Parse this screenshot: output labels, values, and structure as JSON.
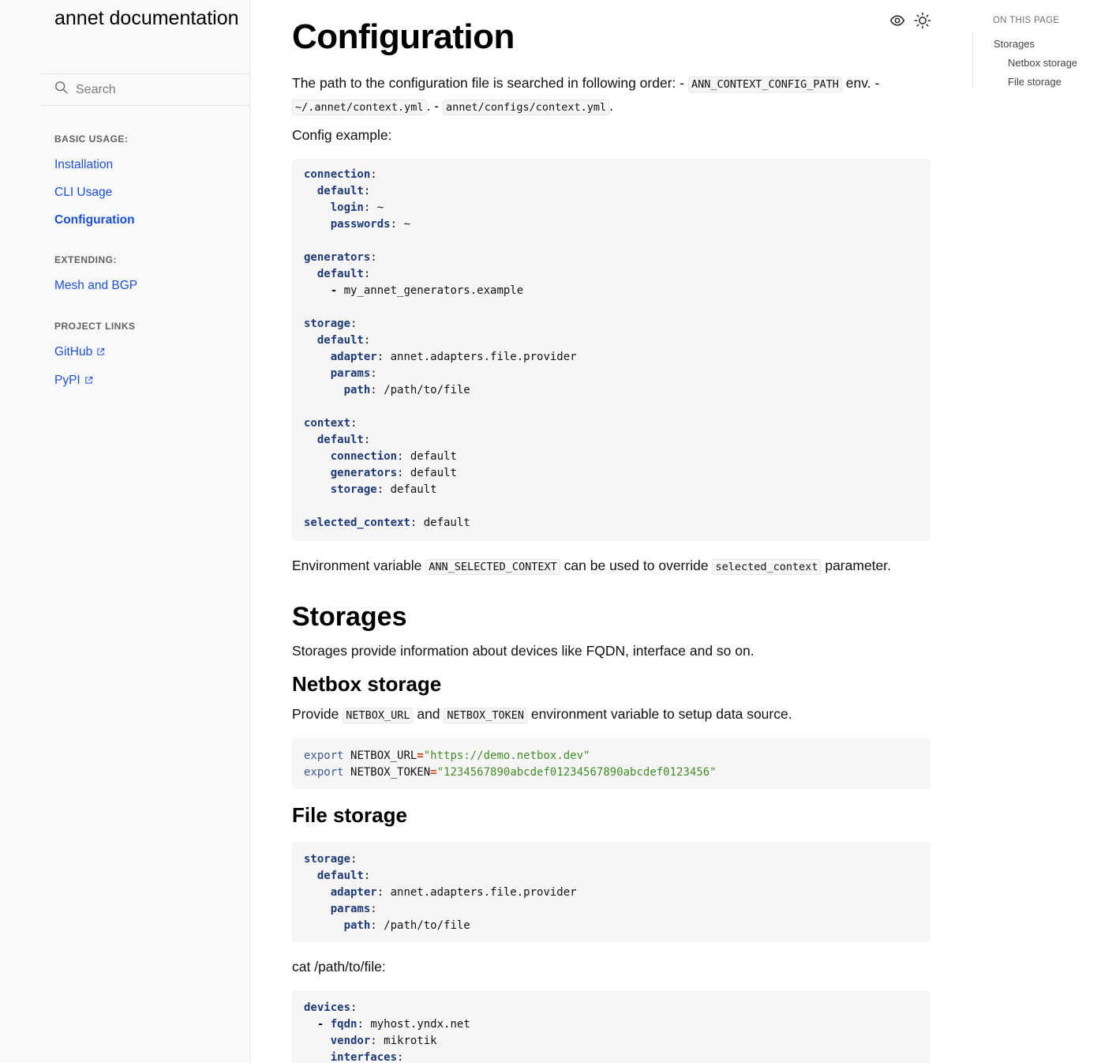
{
  "sidebar": {
    "brand": "annet documentation",
    "search_placeholder": "Search",
    "sections": [
      {
        "caption": "BASIC USAGE:",
        "items": [
          "Installation",
          "CLI Usage",
          "Configuration"
        ]
      },
      {
        "caption": "EXTENDING:",
        "items": [
          "Mesh and BGP"
        ]
      },
      {
        "caption": "PROJECT LINKS",
        "items": [
          "GitHub",
          "PyPI"
        ]
      }
    ],
    "current": "Configuration"
  },
  "toolbar": {
    "view_source_icon": "eye-icon",
    "theme_icon": "sun-icon"
  },
  "toc": {
    "caption": "ON THIS PAGE",
    "items": [
      "Storages",
      "Netbox storage",
      "File storage"
    ]
  },
  "main": {
    "title": "Configuration",
    "intro": {
      "p1_a": "The path to the configuration file is searched in following order: - ",
      "p1_code1": "ANN_CONTEXT_CONFIG_PATH",
      "p1_b": " env. - ",
      "p1_code2": "~/.annet/context.yml",
      "p1_c": ". - ",
      "p1_code3": "annet/configs/context.yml",
      "p1_d": "."
    },
    "config_example_label": "Config example:",
    "env_para": {
      "a": "Environment variable ",
      "code1": "ANN_SELECTED_CONTEXT",
      "b": " can be used to override ",
      "code2": "selected_context",
      "c": " parameter."
    },
    "storages_title": "Storages",
    "storages_text": "Storages provide information about devices like FQDN, interface and so on.",
    "netbox_title": "Netbox storage",
    "netbox_para": {
      "a": "Provide ",
      "code1": "NETBOX_URL",
      "b": " and ",
      "code2": "NETBOX_TOKEN",
      "c": " environment variable to setup data source."
    },
    "netbox_code": {
      "export": "export",
      "var1": "NETBOX_URL",
      "val1": "\"https://demo.netbox.dev\"",
      "var2": "NETBOX_TOKEN",
      "val2": "\"1234567890abcdef01234567890abcdef0123456\""
    },
    "file_title": "File storage",
    "cat_label": "cat /path/to/file:",
    "yaml": {
      "connection": "connection",
      "default": "default",
      "login": "login",
      "passwords": "passwords",
      "tilde": "~",
      "generators": "generators",
      "generator_item": "my_annet_generators.example",
      "storage": "storage",
      "adapter": "adapter",
      "adapter_val": "annet.adapters.file.provider",
      "params": "params",
      "path": "path",
      "path_val": "/path/to/file",
      "context": "context",
      "default_val": "default",
      "selected_context": "selected_context",
      "devices": "devices",
      "fqdn": "fqdn",
      "fqdn_val": "myhost.yndx.net",
      "vendor": "vendor",
      "vendor_val": "mikrotik",
      "interfaces": "interfaces"
    }
  }
}
